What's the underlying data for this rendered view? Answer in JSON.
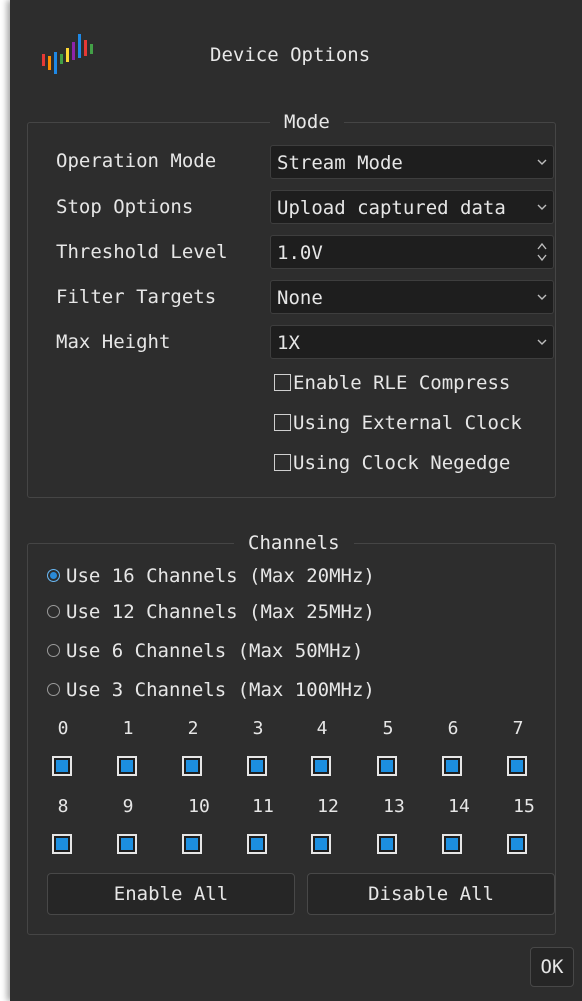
{
  "dialog": {
    "title": "Device Options"
  },
  "mode": {
    "title": "Mode",
    "rows": [
      {
        "label": "Operation Mode",
        "value": "Stream Mode",
        "control": "dropdown"
      },
      {
        "label": "Stop Options",
        "value": "Upload captured data",
        "control": "dropdown"
      },
      {
        "label": "Threshold Level",
        "value": "1.0V",
        "control": "spinbox"
      },
      {
        "label": "Filter Targets",
        "value": "None",
        "control": "dropdown"
      },
      {
        "label": "Max Height",
        "value": "1X",
        "control": "dropdown"
      }
    ],
    "checkboxes": [
      {
        "label": "Enable RLE Compress",
        "checked": false
      },
      {
        "label": "Using External Clock",
        "checked": false
      },
      {
        "label": "Using Clock Negedge",
        "checked": false
      }
    ]
  },
  "channels": {
    "title": "Channels",
    "radios": [
      {
        "label": "Use 16 Channels (Max 20MHz)",
        "selected": true
      },
      {
        "label": "Use 12 Channels (Max 25MHz)",
        "selected": false
      },
      {
        "label": "Use 6 Channels (Max 50MHz)",
        "selected": false
      },
      {
        "label": "Use 3 Channels (Max 100MHz)",
        "selected": false
      }
    ],
    "channel_numbers": [
      "0",
      "1",
      "2",
      "3",
      "4",
      "5",
      "6",
      "7",
      "8",
      "9",
      "10",
      "11",
      "12",
      "13",
      "14",
      "15"
    ],
    "enable_all_label": "Enable All",
    "disable_all_label": "Disable All"
  },
  "ok_label": "OK",
  "colors": {
    "background": "#2d2d2d",
    "accent": "#1c8fe0",
    "field": "#1e1e1e"
  }
}
